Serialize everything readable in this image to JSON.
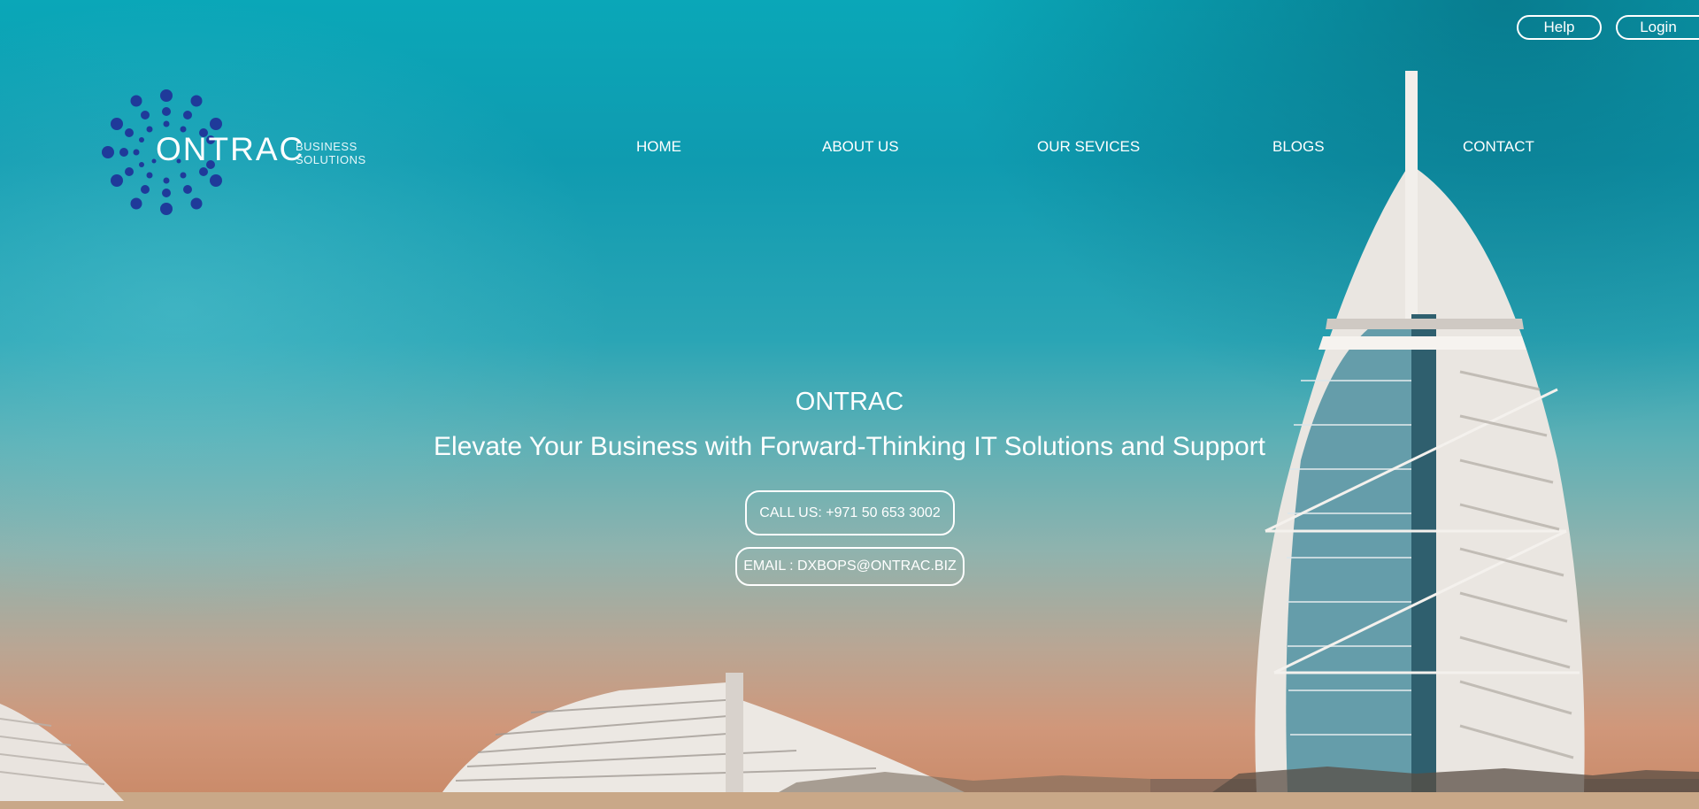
{
  "utility": {
    "help_label": "Help",
    "login_label": "Login"
  },
  "logo": {
    "word": "ONTRAC",
    "sub_line1": "BUSINESS",
    "sub_line2": "SOLUTIONS",
    "dot_color": "#1f3a9a"
  },
  "nav": {
    "items": [
      {
        "label": "HOME"
      },
      {
        "label": "ABOUT US"
      },
      {
        "label": "OUR SEVICES"
      },
      {
        "label": "BLOGS"
      },
      {
        "label": "CONTACT"
      }
    ]
  },
  "hero": {
    "title": "ONTRAC",
    "subtitle": "Elevate Your Business with Forward-Thinking IT Solutions and Support",
    "call_label": "CALL US: +971 50 653 3002",
    "email_label": "EMAIL : DXBOPS@ONTRAC.BIZ"
  },
  "colors": {
    "sky_top": "#0aa7b8",
    "sky_bottom": "#c98866",
    "text": "#ffffff"
  }
}
